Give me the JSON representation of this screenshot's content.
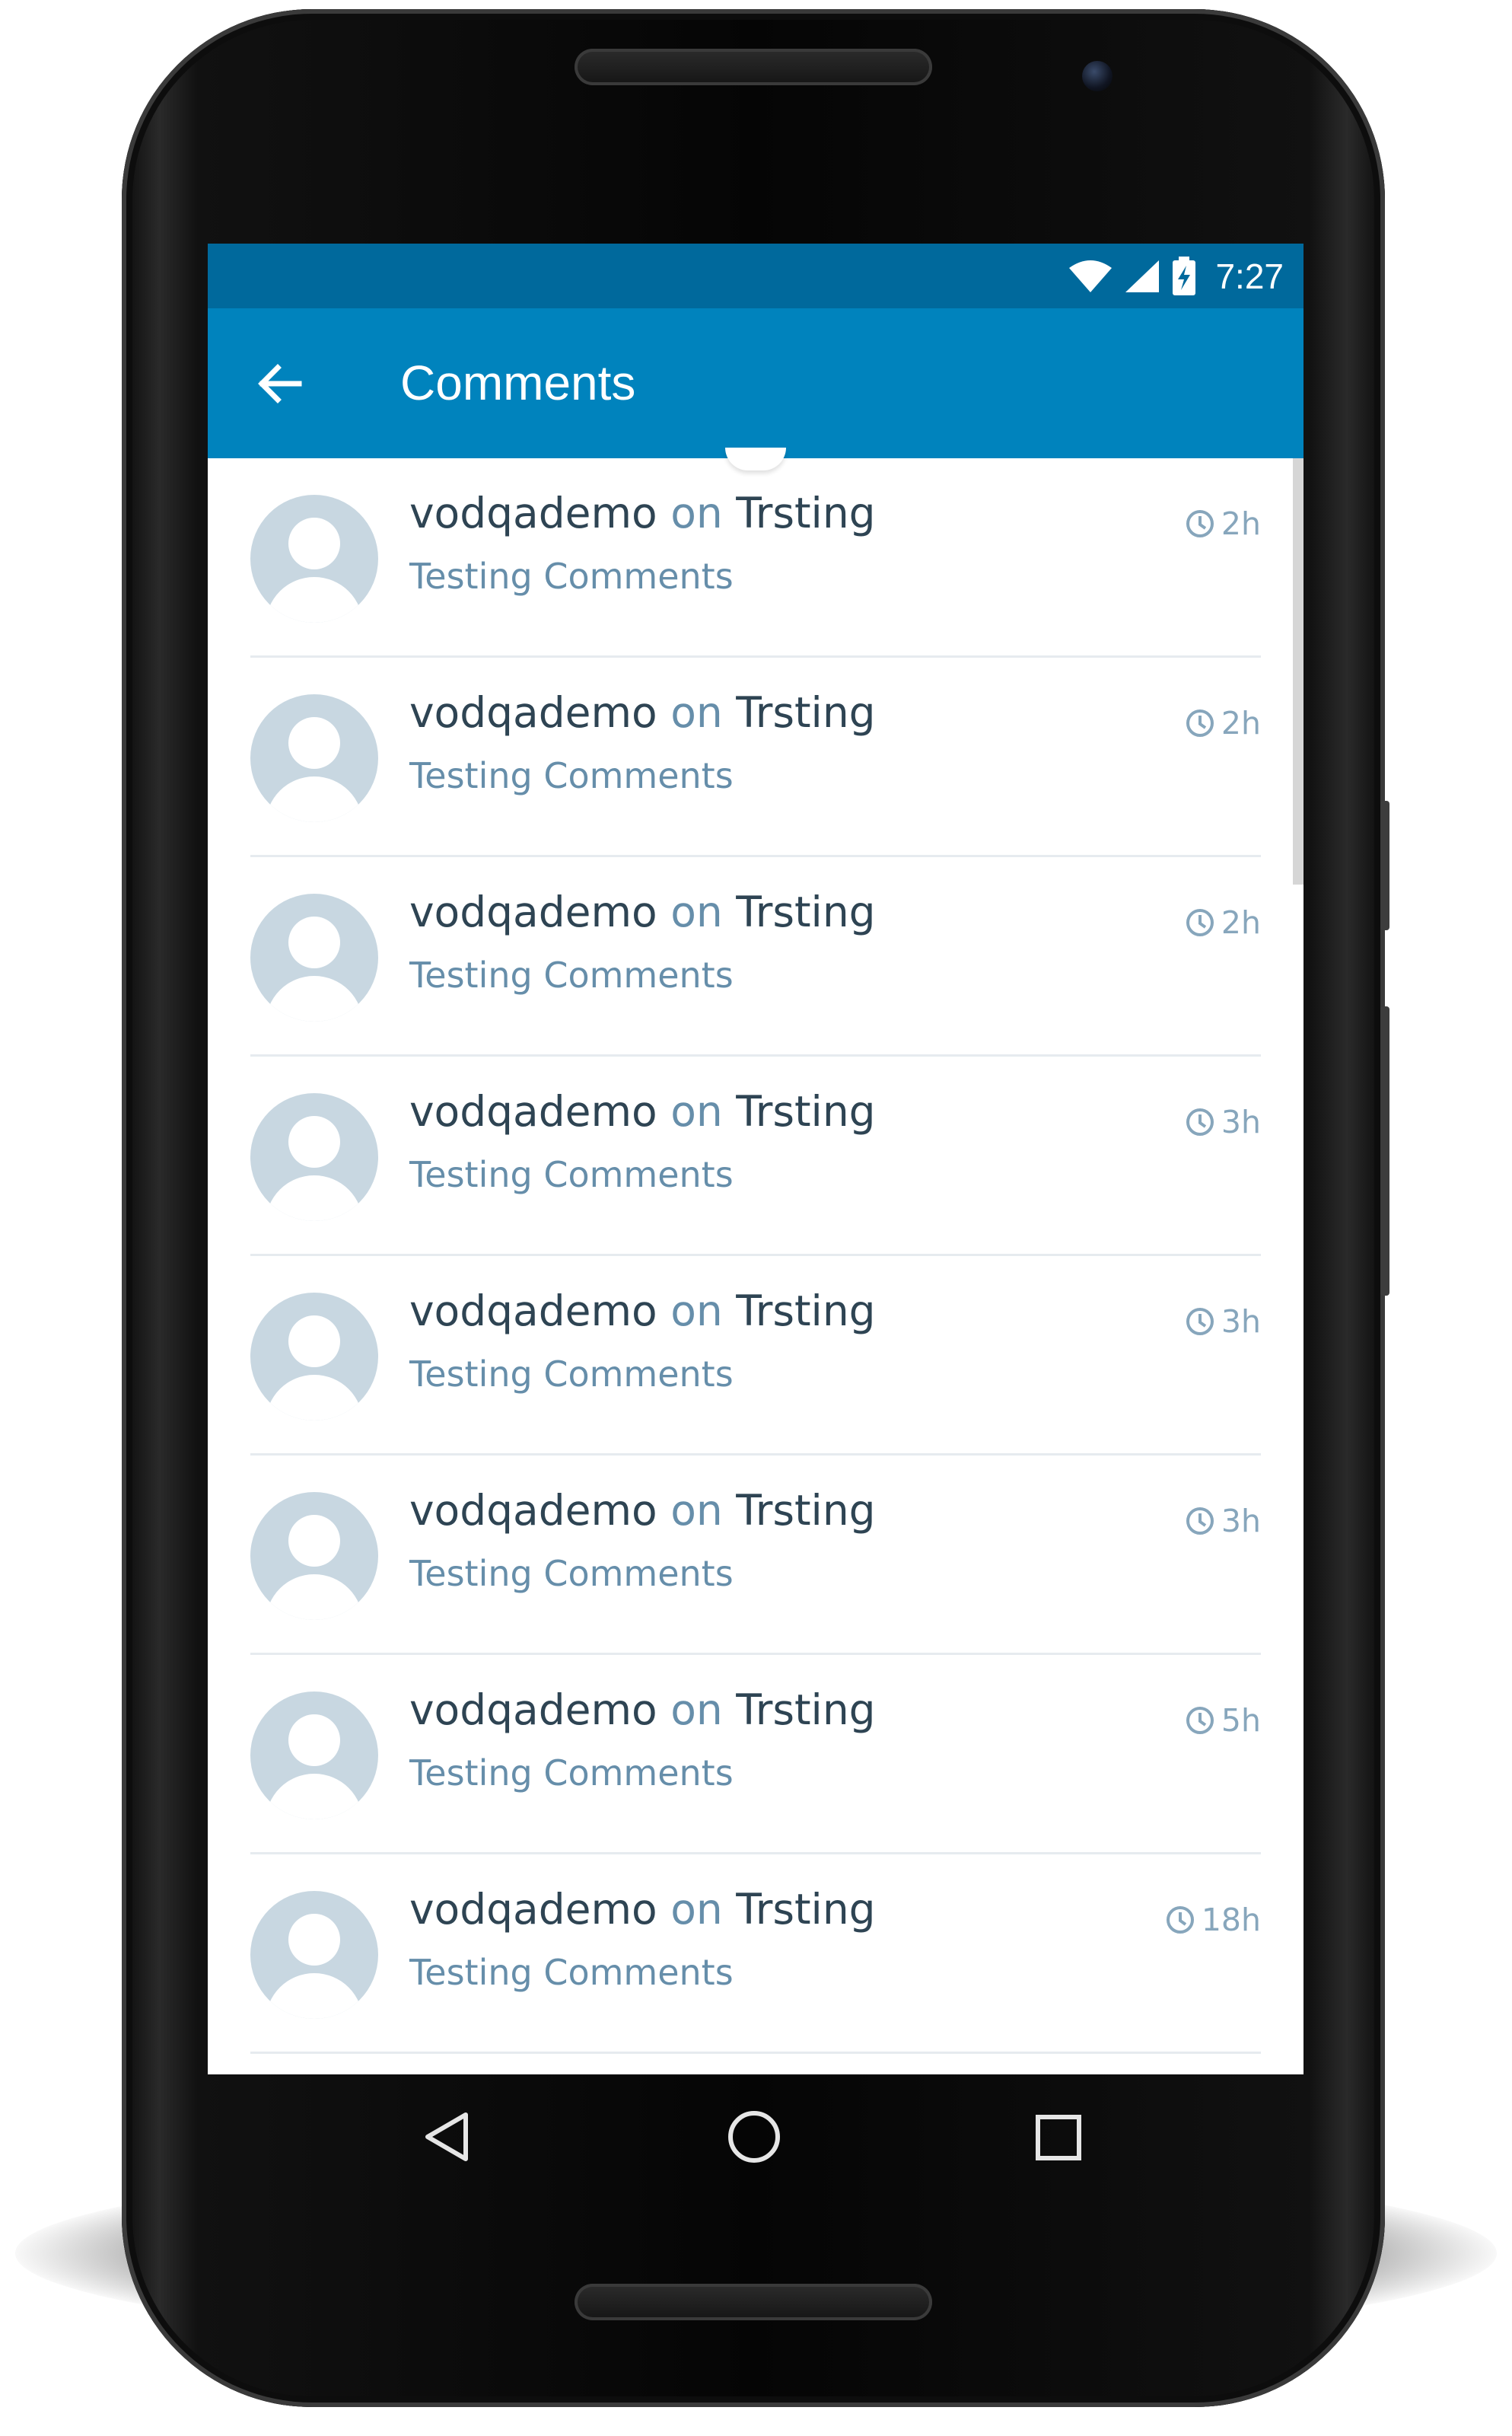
{
  "status_bar": {
    "time": "7:27",
    "icons": [
      "wifi-icon",
      "signal-icon",
      "battery-charging-icon"
    ]
  },
  "app_bar": {
    "title": "Comments",
    "back_icon": "arrow-back-icon"
  },
  "comments": [
    {
      "author": "vodqademo",
      "connector": "on",
      "post": "Trsting",
      "text": "Testing Comments",
      "age": "2h"
    },
    {
      "author": "vodqademo",
      "connector": "on",
      "post": "Trsting",
      "text": "Testing Comments",
      "age": "2h"
    },
    {
      "author": "vodqademo",
      "connector": "on",
      "post": "Trsting",
      "text": "Testing Comments",
      "age": "2h"
    },
    {
      "author": "vodqademo",
      "connector": "on",
      "post": "Trsting",
      "text": "Testing Comments",
      "age": "3h"
    },
    {
      "author": "vodqademo",
      "connector": "on",
      "post": "Trsting",
      "text": "Testing Comments",
      "age": "3h"
    },
    {
      "author": "vodqademo",
      "connector": "on",
      "post": "Trsting",
      "text": "Testing Comments",
      "age": "3h"
    },
    {
      "author": "vodqademo",
      "connector": "on",
      "post": "Trsting",
      "text": "Testing Comments",
      "age": "5h"
    },
    {
      "author": "vodqademo",
      "connector": "on",
      "post": "Trsting",
      "text": "Testing Comments",
      "age": "18h"
    }
  ],
  "nav_bar": {
    "icons": [
      "back-triangle-icon",
      "home-circle-icon",
      "recents-square-icon"
    ]
  },
  "colors": {
    "status_bar": "#00699c",
    "app_bar": "#0083bd",
    "author_text": "#2e4453",
    "secondary_text": "#668eaa",
    "avatar_bg": "#c8d7e1"
  }
}
